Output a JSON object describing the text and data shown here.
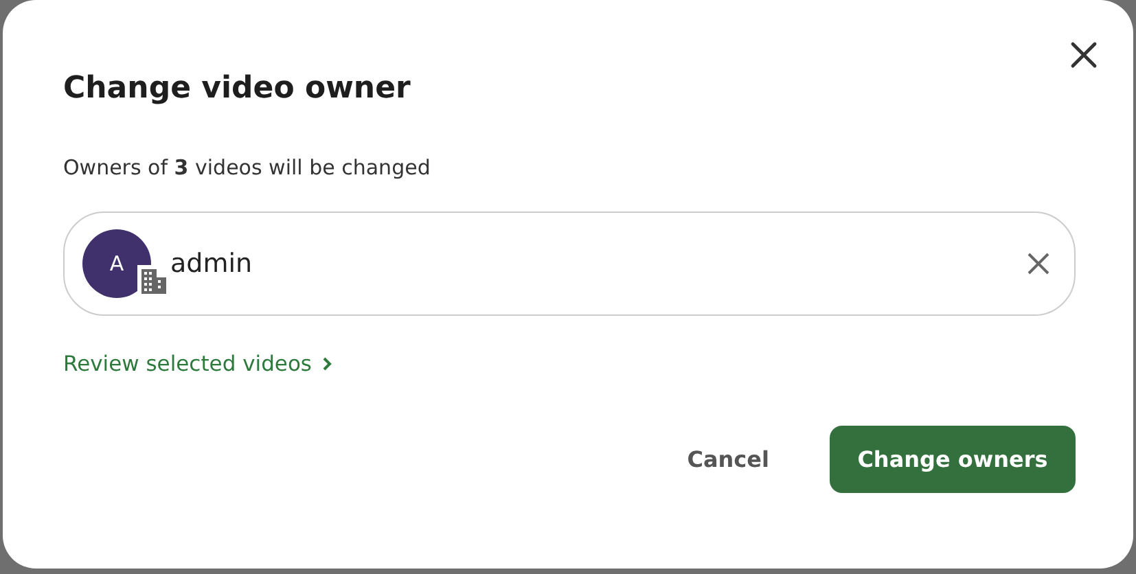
{
  "dialog": {
    "title": "Change video owner",
    "message": "Owners of **3** videos will be changed",
    "owner_field": {
      "avatar_initial": "A",
      "value": "admin"
    },
    "review_link": "Review selected videos",
    "buttons": [
      {
        "kind": "secondary",
        "label": "Cancel"
      },
      {
        "kind": "primary",
        "label": "Change owners"
      }
    ]
  }
}
